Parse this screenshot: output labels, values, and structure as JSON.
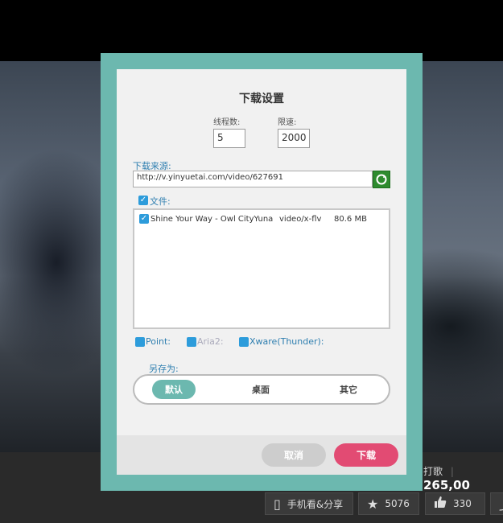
{
  "background": {
    "stats_label": "打歌",
    "stats_count": "265,00",
    "share_label": "手机看&分享",
    "fav_count": "5076",
    "like_count": "330",
    "share_icon": "phone-icon",
    "fav_icon": "star-icon",
    "like_icon": "thumbs-up-icon"
  },
  "dialog": {
    "title": "下载设置",
    "threads_label": "线程数:",
    "threads_value": "5",
    "speed_label": "限速:",
    "speed_value": "2000",
    "source_label": "下载来源:",
    "source_url": "http://v.yinyuetai.com/video/627691",
    "files_label": "文件:",
    "files": [
      {
        "name": "Shine Your Way - Owl CityYuna",
        "type": "video/x-flv",
        "size": "80.6 MB",
        "checked": true
      }
    ],
    "engines": [
      {
        "label": "Point:",
        "enabled": true
      },
      {
        "label": "Aria2:",
        "enabled": false
      },
      {
        "label": "Xware(Thunder):",
        "enabled": true
      }
    ],
    "saveas_label": "另存为:",
    "saveas_options": [
      "默认",
      "桌面",
      "其它"
    ],
    "saveas_selected": "默认",
    "cancel_label": "取消",
    "download_label": "下载"
  },
  "colors": {
    "frame": "#6cb8af",
    "accent_blue": "#2d9cdb",
    "download_button": "#e24b73",
    "cancel_button": "#cdcdcd"
  }
}
